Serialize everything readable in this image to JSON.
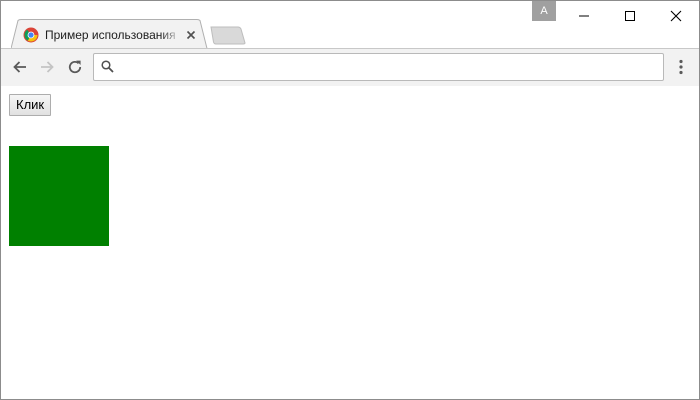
{
  "window": {
    "profile_badge": "A",
    "controls": [
      "minimize",
      "maximize",
      "close"
    ]
  },
  "tab": {
    "title": "Пример использования",
    "favicon": "chrome-favicon-icon",
    "close_icon": "close-icon"
  },
  "new_tab": {
    "icon": "new-tab-icon"
  },
  "toolbar": {
    "back_icon": "arrow-left-icon",
    "forward_icon": "arrow-right-icon",
    "reload_icon": "reload-icon",
    "menu_icon": "more-vert-icon",
    "omnibox": {
      "value": "",
      "placeholder": "",
      "icon": "search-icon"
    }
  },
  "page": {
    "button_label": "Клик",
    "box_color": "#008000"
  },
  "colors": {
    "toolbar_bg": "#f2f2f2",
    "box": "#008000"
  }
}
